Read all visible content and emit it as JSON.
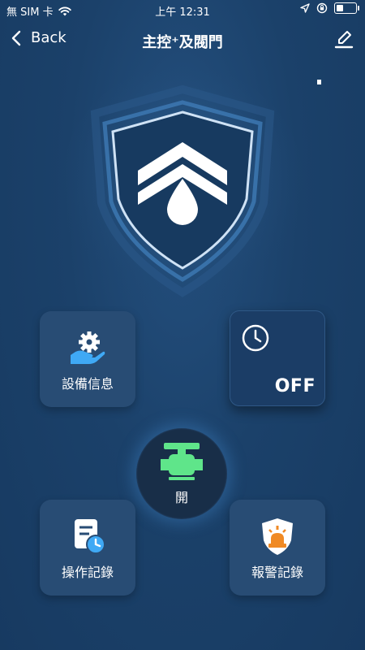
{
  "status_bar": {
    "carrier": "無 SIM 卡",
    "time": "上午 12:31",
    "icons": [
      "wifi-icon",
      "location-arrow-icon",
      "orientation-lock-icon",
      "battery-icon"
    ]
  },
  "nav": {
    "back_label": "Back",
    "title": "主控⁺及閥門",
    "edit_icon": "pencil-icon"
  },
  "hero": {
    "icon": "shield-water-drop-icon"
  },
  "tiles": {
    "device_info": {
      "label": "設備信息",
      "icon": "gear-hand-icon"
    },
    "timer": {
      "state": "OFF",
      "icon": "clock-icon"
    },
    "operation_log": {
      "label": "操作記錄",
      "icon": "document-clock-icon"
    },
    "alarm_log": {
      "label": "報警記錄",
      "icon": "alarm-siren-shield-icon"
    }
  },
  "valve": {
    "label": "開",
    "icon": "valve-icon",
    "color": "#5fe58a"
  },
  "colors": {
    "background": "#1b416a",
    "tile": "#284c74",
    "accent_blue": "#3fa9f5",
    "valve_green": "#5fe58a",
    "alarm_orange": "#f08a24"
  }
}
